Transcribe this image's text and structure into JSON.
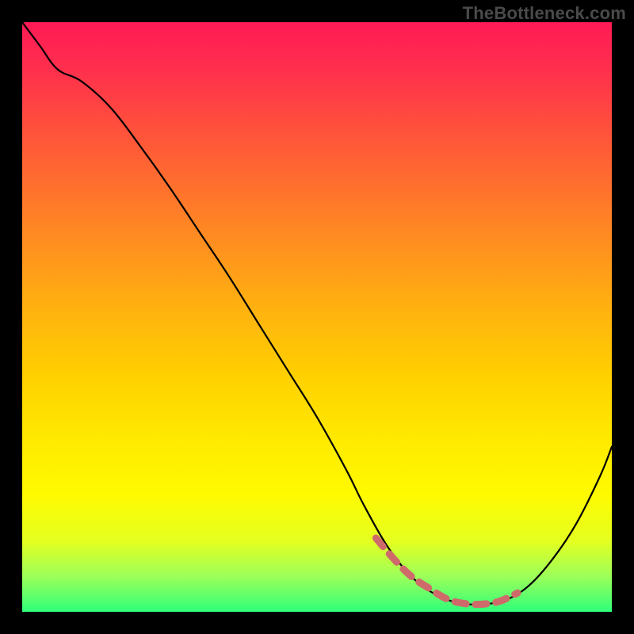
{
  "watermark": {
    "text": "TheBottleneck.com"
  },
  "colors": {
    "curve_stroke": "#000000",
    "overlay_stroke": "#cf6a6a",
    "frame_bg": "#000000",
    "gradient_top": "#ff1a55",
    "gradient_bottom": "#2fff7a"
  },
  "chart_data": {
    "type": "line",
    "title": "",
    "xlabel": "",
    "ylabel": "",
    "xlim": [
      0,
      100
    ],
    "ylim": [
      0,
      100
    ],
    "series": [
      {
        "name": "main-curve",
        "x": [
          0,
          3,
          6,
          10,
          15,
          20,
          25,
          30,
          35,
          40,
          45,
          50,
          55,
          58,
          62,
          66,
          70,
          74,
          78,
          82,
          86,
          90,
          94,
          98,
          100
        ],
        "y": [
          100,
          96,
          92,
          90,
          85.5,
          79,
          72,
          64.5,
          57,
          49,
          41,
          33,
          24,
          18,
          11,
          6,
          3,
          1.5,
          1.3,
          2,
          4.5,
          9,
          15,
          23,
          28
        ]
      },
      {
        "name": "highlight-segment",
        "x": [
          60,
          63,
          66,
          69,
          72,
          75,
          78,
          81,
          84
        ],
        "y": [
          12.5,
          9,
          6,
          4,
          2.2,
          1.4,
          1.3,
          1.8,
          3.2
        ]
      }
    ],
    "annotations": []
  }
}
